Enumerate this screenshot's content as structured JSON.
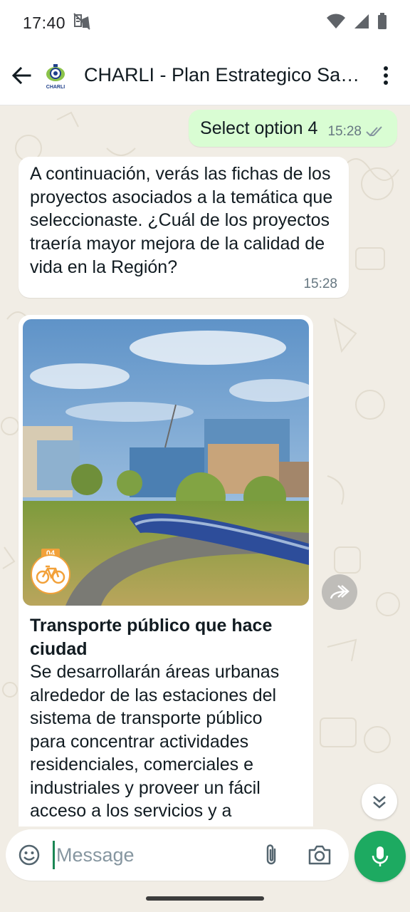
{
  "status_bar": {
    "time": "17:40",
    "icons": [
      "notification-icon",
      "wifi-icon",
      "signal-icon",
      "battery-icon"
    ]
  },
  "header": {
    "title": "CHARLI - Plan Estrategico Santiago",
    "avatar_text": "CHARLI",
    "icons": [
      "back-arrow-icon",
      "more-vert-icon"
    ]
  },
  "messages": [
    {
      "direction": "outgoing",
      "text": "Select option 4",
      "time": "15:28",
      "status": "read"
    },
    {
      "direction": "incoming",
      "text": "A continuación, verás las fichas de los proyectos asociados a la temática que seleccionaste. ¿Cuál de los proyectos traería mayor mejora de la calidad de vida en la Región?",
      "time": "15:28"
    },
    {
      "direction": "incoming",
      "type": "card",
      "badge_number": "04",
      "badge_icon": "bicycle-icon",
      "title": "Transporte público que hace ciudad",
      "body": "Se desarrollarán áreas urbanas alrededor de las estaciones del sistema de transporte público para concentrar actividades residenciales, comerciales e industriales y proveer un fácil acceso a los servicios y a espacios públicos de calidad."
    }
  ],
  "composer": {
    "placeholder": "Message",
    "icons": [
      "emoji-icon",
      "paperclip-icon",
      "camera-icon",
      "microphone-icon"
    ]
  },
  "colors": {
    "outgoing_bubble": "#d9fdd3",
    "incoming_bubble": "#ffffff",
    "chat_background": "#f1ede5",
    "accent_green": "#1daa61",
    "read_ticks": "#8696a0"
  }
}
